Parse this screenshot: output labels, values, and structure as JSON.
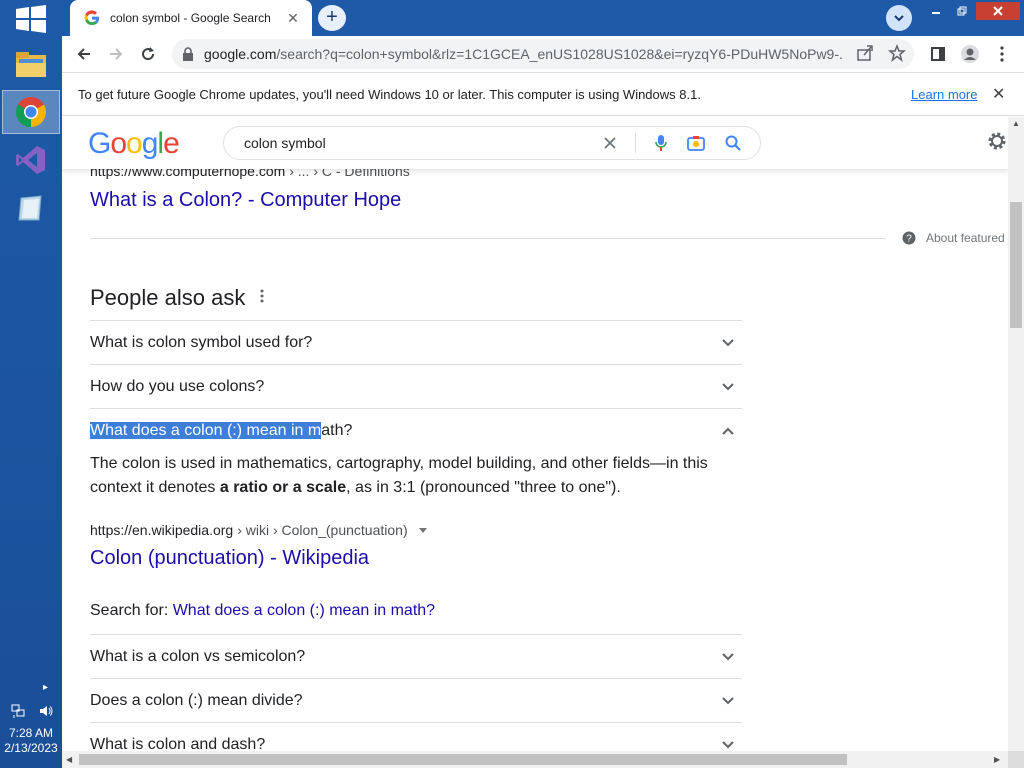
{
  "taskbar": {
    "apps": [
      {
        "name": "File Explorer",
        "icon": "folder-icon"
      },
      {
        "name": "Google Chrome",
        "icon": "chrome-icon",
        "active": true
      },
      {
        "name": "Visual Studio",
        "icon": "visual-studio-icon"
      },
      {
        "name": "Notebook app",
        "icon": "notebook-icon"
      }
    ],
    "clock": {
      "time": "7:28 AM",
      "date": "2/13/2023"
    }
  },
  "browser": {
    "tab": {
      "title": "colon symbol - Google Search"
    },
    "url_host": "google.com",
    "url_rest": "/search?q=colon+symbol&rlz=1C1GCEA_enUS1028US1028&ei=ryzqY6-PDuHW5NoPw9-...",
    "infobar": {
      "text": "To get future Google Chrome updates, you'll need Windows 10 or later. This computer is using Windows 8.1.",
      "link": "Learn more"
    }
  },
  "google": {
    "logo": "Google",
    "query": "colon symbol",
    "prev_result": {
      "cite_host": "https://www.computerhope.com",
      "cite_path": " › ... › C - Definitions",
      "title": "What is a Colon? - Computer Hope"
    },
    "about_featured": "About featured",
    "paa": {
      "title": "People also ask",
      "questions": [
        {
          "text": "What is colon symbol used for?",
          "expanded": false
        },
        {
          "text": "How do you use colons?",
          "expanded": false
        },
        {
          "text_selected": "What does a colon (:) mean in m",
          "text_rest": "ath?",
          "expanded": true
        },
        {
          "text": "What is a colon vs semicolon?",
          "expanded": false
        },
        {
          "text": "Does a colon (:) mean divide?",
          "expanded": false
        },
        {
          "text": "What is colon and dash?",
          "expanded": false
        }
      ],
      "answer": {
        "part1": "The colon is used in mathematics, cartography, model building, and other fields—in this context it denotes ",
        "bold": "a ratio or a scale",
        "part2": ", as in 3:1 (pronounced \"three to one\")."
      },
      "source": {
        "cite_host": "https://en.wikipedia.org",
        "cite_path": " › wiki › Colon_(punctuation)",
        "title": "Colon (punctuation) - Wikipedia"
      },
      "search_for_label": "Search for: ",
      "search_for_link": "What does a colon (:) mean in math?"
    }
  },
  "colors": {
    "taskbar": "#1e5aa8",
    "link": "#1a0dab",
    "selection": "#3d7ed8",
    "close": "#c84031"
  }
}
